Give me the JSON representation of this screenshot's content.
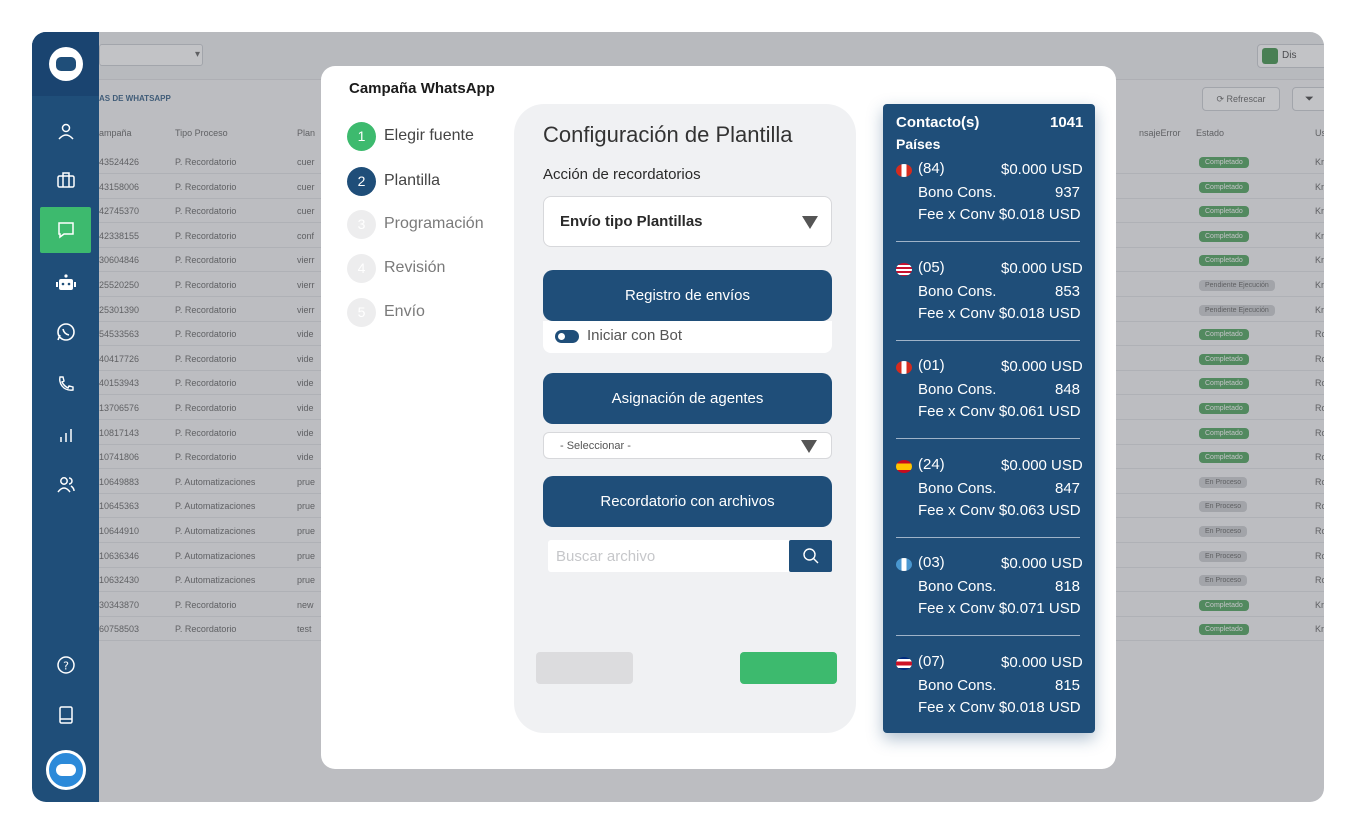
{
  "sidebar": {
    "icons": [
      "logo-icon",
      "user-icon",
      "briefcase-icon",
      "chat-icon",
      "robot-icon",
      "whatsapp-icon",
      "phone-icon",
      "bar-chart-icon",
      "users-icon",
      "help-icon",
      "book-icon",
      "bot-avatar-icon"
    ],
    "active": "chat-icon",
    "accent_color": "#3dba6e",
    "background_color": "#1f4e79"
  },
  "background": {
    "section_title": "AS DE WHATSAPP",
    "refresh_label": "Refrescar",
    "toggle_label": "Dis",
    "columns": [
      "ampaña",
      "Tipo Proceso",
      "Plan",
      "nsajeError",
      "Estado",
      "Us"
    ],
    "rows": [
      {
        "id": "43524426",
        "tipo": "P. Recordatorio",
        "plan": "cuer",
        "estado": "Completado",
        "us": "Kr"
      },
      {
        "id": "43158006",
        "tipo": "P. Recordatorio",
        "plan": "cuer",
        "estado": "Completado",
        "us": "Kr"
      },
      {
        "id": "42745370",
        "tipo": "P. Recordatorio",
        "plan": "cuer",
        "estado": "Completado",
        "us": "Kr"
      },
      {
        "id": "42338155",
        "tipo": "P. Recordatorio",
        "plan": "conf",
        "estado": "Completado",
        "us": "Kr"
      },
      {
        "id": "30604846",
        "tipo": "P. Recordatorio",
        "plan": "vierr",
        "estado": "Completado",
        "us": "Kr"
      },
      {
        "id": "25520250",
        "tipo": "P. Recordatorio",
        "plan": "vierr",
        "estado": "Pendiente Ejecución",
        "us": "Kr"
      },
      {
        "id": "25301390",
        "tipo": "P. Recordatorio",
        "plan": "vierr",
        "estado": "Pendiente Ejecución",
        "us": "Kr"
      },
      {
        "id": "54533563",
        "tipo": "P. Recordatorio",
        "plan": "vide",
        "estado": "Completado",
        "us": "Ro"
      },
      {
        "id": "40417726",
        "tipo": "P. Recordatorio",
        "plan": "vide",
        "estado": "Completado",
        "us": "Ro"
      },
      {
        "id": "40153943",
        "tipo": "P. Recordatorio",
        "plan": "vide",
        "estado": "Completado",
        "us": "Ro"
      },
      {
        "id": "13706576",
        "tipo": "P. Recordatorio",
        "plan": "vide",
        "estado": "Completado",
        "us": "Ro"
      },
      {
        "id": "10817143",
        "tipo": "P. Recordatorio",
        "plan": "vide",
        "estado": "Completado",
        "us": "Ro"
      },
      {
        "id": "10741806",
        "tipo": "P. Recordatorio",
        "plan": "vide",
        "estado": "Completado",
        "us": "Ro"
      },
      {
        "id": "10649883",
        "tipo": "P. Automatizaciones",
        "plan": "prue",
        "estado": "En Proceso",
        "us": "Ro"
      },
      {
        "id": "10645363",
        "tipo": "P. Automatizaciones",
        "plan": "prue",
        "estado": "En Proceso",
        "us": "Ro"
      },
      {
        "id": "10644910",
        "tipo": "P. Automatizaciones",
        "plan": "prue",
        "estado": "En Proceso",
        "us": "Ro"
      },
      {
        "id": "10636346",
        "tipo": "P. Automatizaciones",
        "plan": "prue",
        "estado": "En Proceso",
        "us": "Ro"
      },
      {
        "id": "10632430",
        "tipo": "P. Automatizaciones",
        "plan": "prue",
        "estado": "En Proceso",
        "us": "Ro"
      },
      {
        "id": "30343870",
        "tipo": "P. Recordatorio",
        "plan": "new",
        "estado": "Completado",
        "us": "Kr"
      },
      {
        "id": "60758503",
        "tipo": "P. Recordatorio",
        "plan": "test",
        "estado": "Completado",
        "us": "Kr"
      }
    ]
  },
  "modal": {
    "title": "Campaña WhatsApp",
    "steps": [
      {
        "num": "1",
        "label": "Elegir fuente",
        "state": "done"
      },
      {
        "num": "2",
        "label": "Plantilla",
        "state": "current"
      },
      {
        "num": "3",
        "label": "Programación",
        "state": "pending"
      },
      {
        "num": "4",
        "label": "Revisión",
        "state": "pending"
      },
      {
        "num": "5",
        "label": "Envío",
        "state": "pending"
      }
    ],
    "panel": {
      "title": "Configuración de Plantilla",
      "action_label": "Acción de recordatorios",
      "action_value": "Envío tipo Plantillas",
      "registro_button": "Registro de envíos",
      "bot_toggle_label": "Iniciar con Bot",
      "asignacion_button": "Asignación de agentes",
      "agentes_select": "- Seleccionar -",
      "archivos_button": "Recordatorio con archivos",
      "search_placeholder": "Buscar archivo"
    }
  },
  "contacts": {
    "title": "Contacto(s)",
    "total": "1041",
    "paises_label": "Países",
    "bono_label": "Bono Cons.",
    "fee_label": "Fee x Conv",
    "countries": [
      {
        "flag": "peru-flag-icon",
        "count": "(84)",
        "usd": "$0.000 USD",
        "bono": "937",
        "fee": "$0.018 USD"
      },
      {
        "flag": "usa-flag-icon",
        "count": "(05)",
        "usd": "$0.000 USD",
        "bono": "853",
        "fee": "$0.018 USD"
      },
      {
        "flag": "peru-flag-icon",
        "count": "(01)",
        "usd": "$0.000 USD",
        "bono": "848",
        "fee": "$0.061 USD"
      },
      {
        "flag": "spain-flag-icon",
        "count": "(24)",
        "usd": "$0.000 USD",
        "bono": "847",
        "fee": "$0.063 USD"
      },
      {
        "flag": "guatemala-flag-icon",
        "count": "(03)",
        "usd": "$0.000 USD",
        "bono": "818",
        "fee": "$0.071 USD"
      },
      {
        "flag": "costa-rica-flag-icon",
        "count": "(07)",
        "usd": "$0.000 USD",
        "bono": "815",
        "fee": "$0.018 USD"
      }
    ]
  }
}
